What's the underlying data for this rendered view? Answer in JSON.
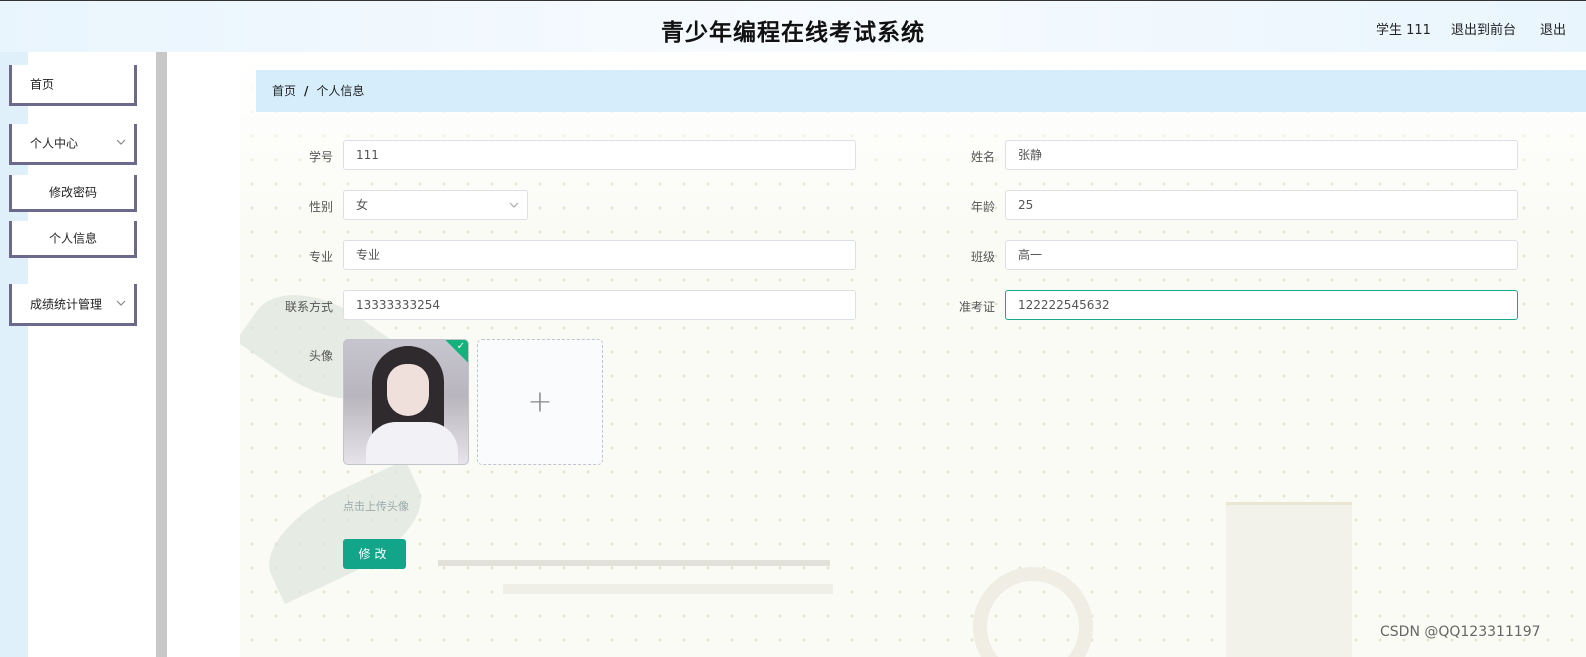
{
  "header": {
    "title": "青少年编程在线考试系统",
    "user": "学生 111",
    "back_to_front": "退出到前台",
    "logout": "退出"
  },
  "sidebar": {
    "items": [
      {
        "label": "首页"
      },
      {
        "label": "个人中心",
        "icon": "chevron-down-icon"
      },
      {
        "label": "修改密码"
      },
      {
        "label": "个人信息"
      },
      {
        "label": "成绩统计管理",
        "icon": "chevron-down-icon"
      }
    ]
  },
  "breadcrumb": {
    "home": "首页",
    "separator": "/",
    "current": "个人信息"
  },
  "form": {
    "student_id": {
      "label": "学号",
      "value": "111"
    },
    "name": {
      "label": "姓名",
      "value": "张静"
    },
    "gender": {
      "label": "性别",
      "value": "女",
      "icon": "chevron-down-icon"
    },
    "age": {
      "label": "年龄",
      "value": "25"
    },
    "major": {
      "label": "专业",
      "value": "专业"
    },
    "class": {
      "label": "班级",
      "value": "高一"
    },
    "contact": {
      "label": "联系方式",
      "value": "13333333254"
    },
    "exam_ticket": {
      "label": "准考证",
      "value": "122222545632"
    },
    "avatar": {
      "label": "头像",
      "tip": "点击上传头像",
      "plus": "+"
    },
    "submit": "修改"
  },
  "watermark": "CSDN @QQ123311197",
  "colors": {
    "accent": "#13a58a",
    "breadcrumb_bg": "#d6eefb",
    "menu_border": "#6b6a8c"
  }
}
